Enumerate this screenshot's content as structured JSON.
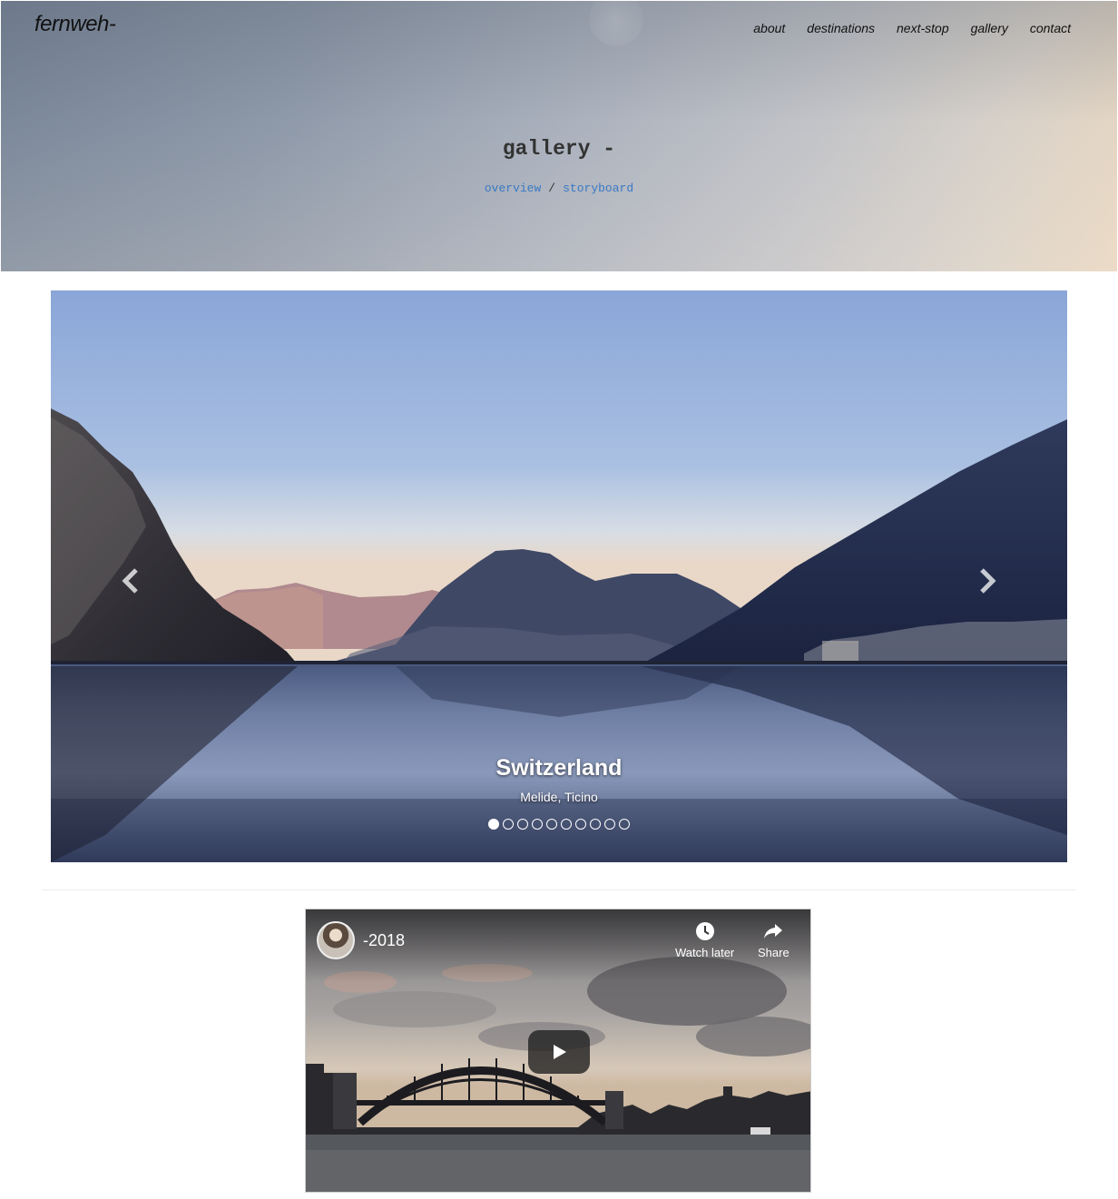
{
  "header": {
    "brand": "fernweh-",
    "nav": [
      {
        "label": "about"
      },
      {
        "label": "destinations"
      },
      {
        "label": "next-stop"
      },
      {
        "label": "gallery"
      },
      {
        "label": "contact"
      }
    ],
    "title": "gallery -",
    "links": {
      "overview": "overview",
      "separator": "/",
      "storyboard": "storyboard"
    }
  },
  "carousel": {
    "caption_title": "Switzerland",
    "caption_subtitle": "Melide, Ticino",
    "slide_count": 10,
    "active_index": 0,
    "prev_icon": "chevron-left-icon",
    "next_icon": "chevron-right-icon"
  },
  "video": {
    "title": "-2018",
    "watch_later": "Watch later",
    "share": "Share",
    "play_icon": "play-icon"
  },
  "colors": {
    "link": "#3a79c4",
    "text": "#111111"
  }
}
